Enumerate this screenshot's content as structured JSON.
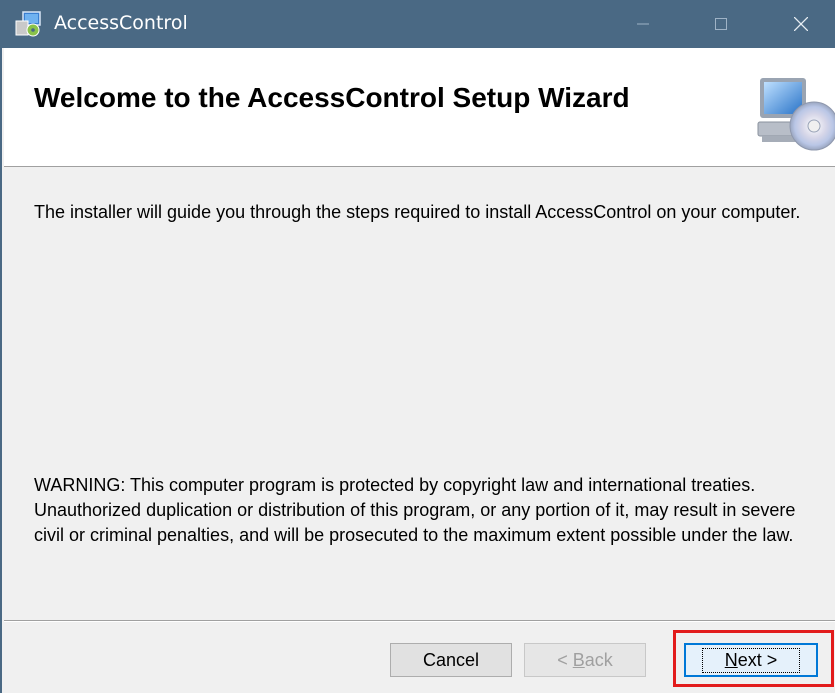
{
  "window": {
    "title": "AccessControl",
    "titlebar_color": "#4a6984",
    "icons": {
      "app": "installer-app-icon",
      "minimize": "minimize-icon",
      "maximize": "maximize-icon",
      "close": "close-icon"
    }
  },
  "header": {
    "title": "Welcome to the AccessControl Setup Wizard",
    "icon": "computer-cd-icon"
  },
  "body": {
    "intro": "The installer will guide you through the steps required to install AccessControl on your computer.",
    "warning": "WARNING: This computer program is protected by copyright law and international treaties. Unauthorized duplication or distribution of this program, or any portion of it, may result in severe civil or criminal penalties, and will be prosecuted to the maximum extent possible under the law."
  },
  "buttons": {
    "cancel": {
      "label": "Cancel"
    },
    "back": {
      "prefix": "< ",
      "mnemonic": "B",
      "rest": "ack",
      "enabled": false
    },
    "next": {
      "mnemonic": "N",
      "rest": "ext >",
      "focused": true
    }
  },
  "annotation": {
    "highlight_color": "#e21b1b"
  }
}
